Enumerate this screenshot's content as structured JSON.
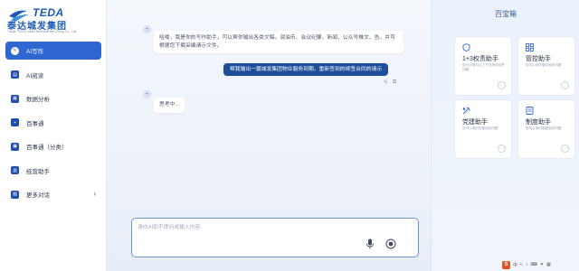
{
  "brand": {
    "name_en": "TEDA",
    "name_cn": "泰达城发集团",
    "subtitle": "Tianjin TEDA Urban Development Group Co., Ltd."
  },
  "nav": {
    "items": [
      {
        "label": "AI写作",
        "icon": "pen-icon",
        "active": true
      },
      {
        "label": "AI阅读",
        "icon": "book-icon"
      },
      {
        "label": "数据分析",
        "icon": "analysis-icon"
      },
      {
        "label": "百事通",
        "icon": "chat-icon"
      },
      {
        "label": "百事通（分类）",
        "icon": "category-icon"
      },
      {
        "label": "经营助手",
        "icon": "chart-icon"
      },
      {
        "label": "更多对话",
        "icon": "more-icon",
        "has_chevron": true
      }
    ],
    "chevron": "›"
  },
  "chat": {
    "messages": [
      {
        "role": "ai",
        "text": "哈喽，我是你的写作助手，可以帮你输出各类文稿，润油币、会议纪要、新闻、公众号推文、告，并可根据您下载采编请示文件。"
      },
      {
        "role": "user",
        "text": "帮我输出一篇城发集团物业服务到期，重新签到的续签合同的请示"
      },
      {
        "role": "ai",
        "text": "思考中..."
      }
    ],
    "input_placeholder": "请向AI助手提问或输入内容...",
    "input_value": ""
  },
  "panel": {
    "title": "百宝箱",
    "cards": [
      {
        "title": "1+3权责助手",
        "desc": "您可以询问以上下月相关权责问题",
        "icon": "shield-icon"
      },
      {
        "title": "管控助手",
        "desc": "您可以询问管控相关问题",
        "icon": "grid-icon"
      },
      {
        "title": "党建助手",
        "desc": "您可以询问党建相关问题",
        "icon": "party-icon"
      },
      {
        "title": "制度助手",
        "desc": "您可以询问制度相关问题",
        "icon": "document-icon"
      }
    ],
    "arrow": "→"
  },
  "tray": {
    "logo": "S",
    "lang": "中"
  },
  "colors": {
    "accent": "#2f66d0",
    "user_bubble": "#1e4e9a",
    "brand": "#1a5bb5"
  }
}
